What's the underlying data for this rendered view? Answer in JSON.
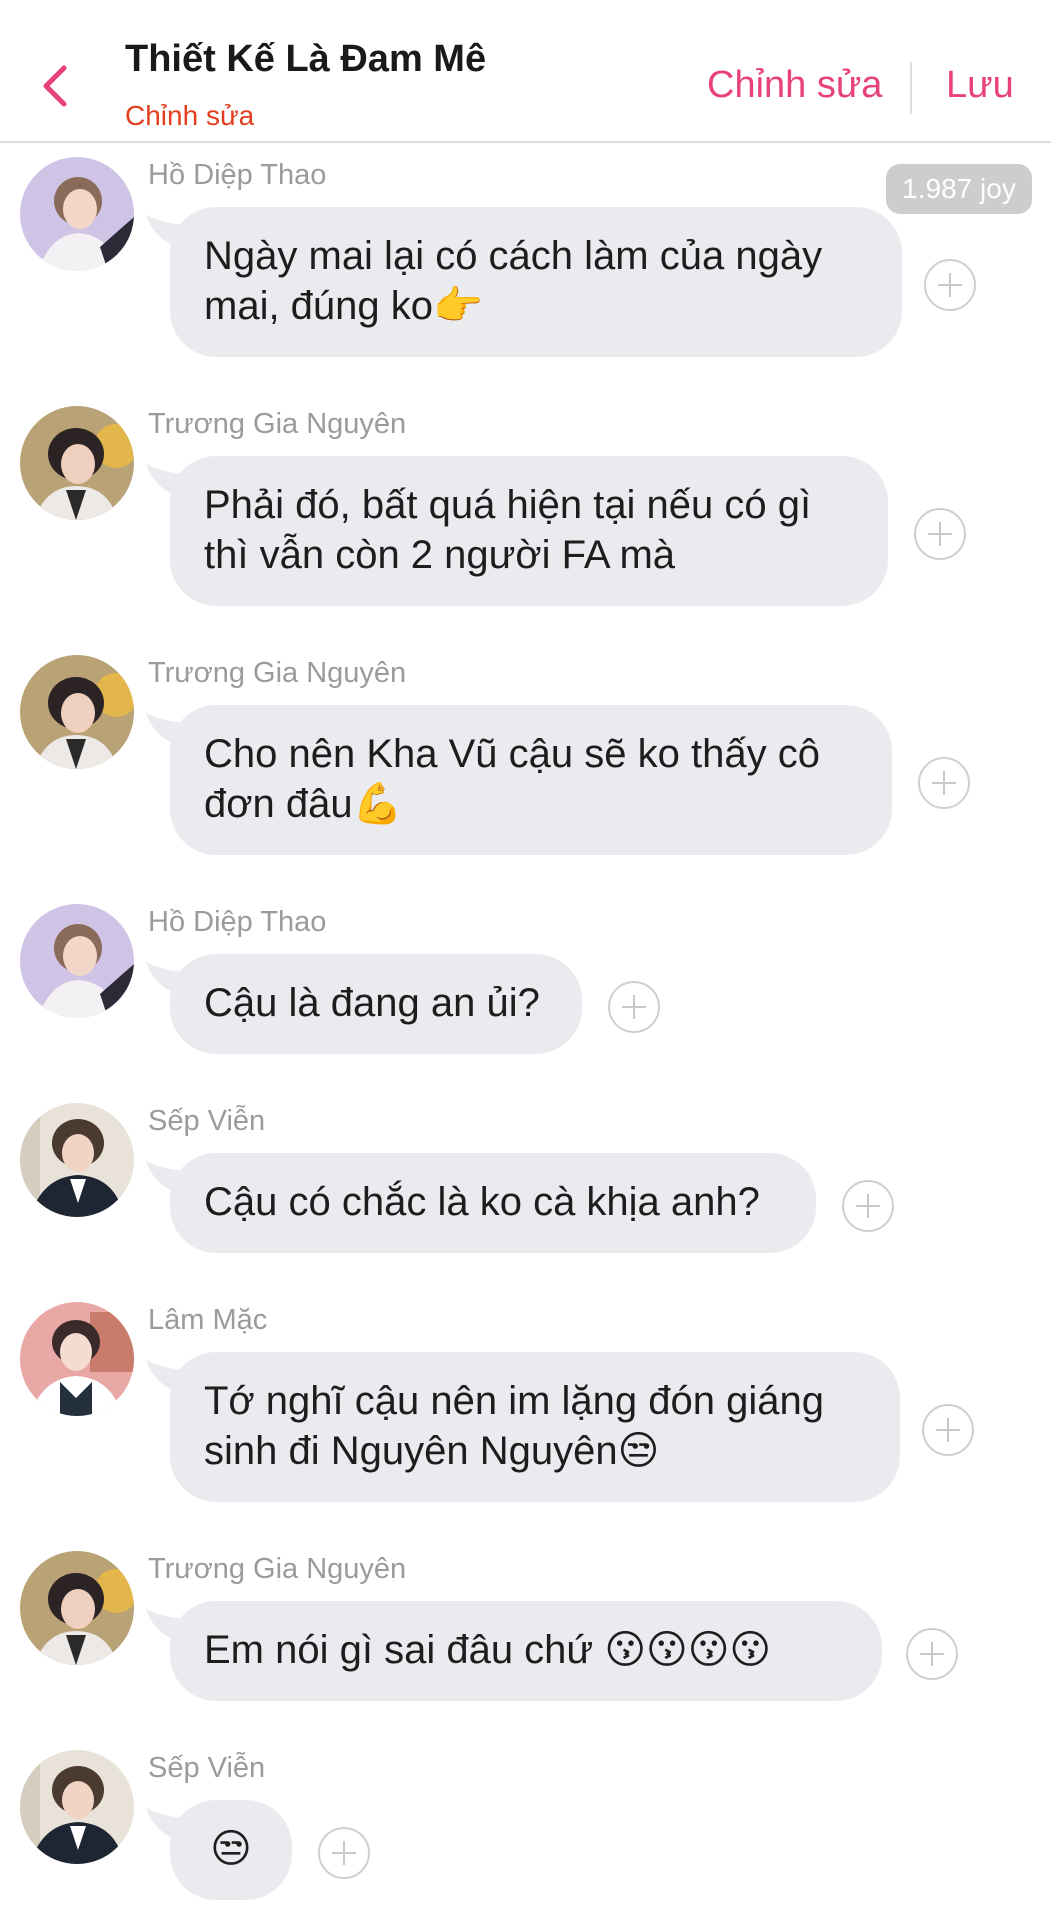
{
  "header": {
    "title": "Thiết Kế Là Đam Mê",
    "subtitle": "Chỉnh sửa",
    "edit_label": "Chỉnh sửa",
    "save_label": "Lưu",
    "back_icon": "chevron-left-icon",
    "accent_color": "#e8427a",
    "subtitle_color": "#e33e1e"
  },
  "badge": {
    "text": "1.987 joy"
  },
  "messages": [
    {
      "sender": "Hồ Diệp Thao",
      "lines": [
        "Ngày mai lại có cách làm của ngày",
        "mai, đúng ko👉"
      ]
    },
    {
      "sender": "Trương Gia Nguyên",
      "lines": [
        "Phải đó, bất quá hiện tại nếu có gì",
        "thì vẫn còn 2 người FA mà"
      ]
    },
    {
      "sender": "Trương Gia Nguyên",
      "lines": [
        "Cho nên Kha Vũ cậu sẽ ko thấy cô",
        "đơn đâu💪"
      ]
    },
    {
      "sender": "Hồ Diệp Thao",
      "lines": [
        "Cậu là đang an ủi?"
      ]
    },
    {
      "sender": "Sếp Viễn",
      "lines": [
        "Cậu có chắc là ko cà khịa anh?"
      ]
    },
    {
      "sender": "Lâm Mặc",
      "lines": [
        "Tớ nghĩ cậu nên im lặng đón giáng",
        "sinh đi Nguyên Nguyên😒"
      ]
    },
    {
      "sender": "Trương Gia Nguyên",
      "lines": [
        "Em nói gì sai đâu chứ 😗😗😗😗"
      ]
    },
    {
      "sender": "Sếp Viễn",
      "lines": [
        "😒"
      ]
    }
  ],
  "colors": {
    "bubble": "#e9ebef",
    "sender_text": "#9b9b9b",
    "badge_bg": "#cdcdcd"
  }
}
